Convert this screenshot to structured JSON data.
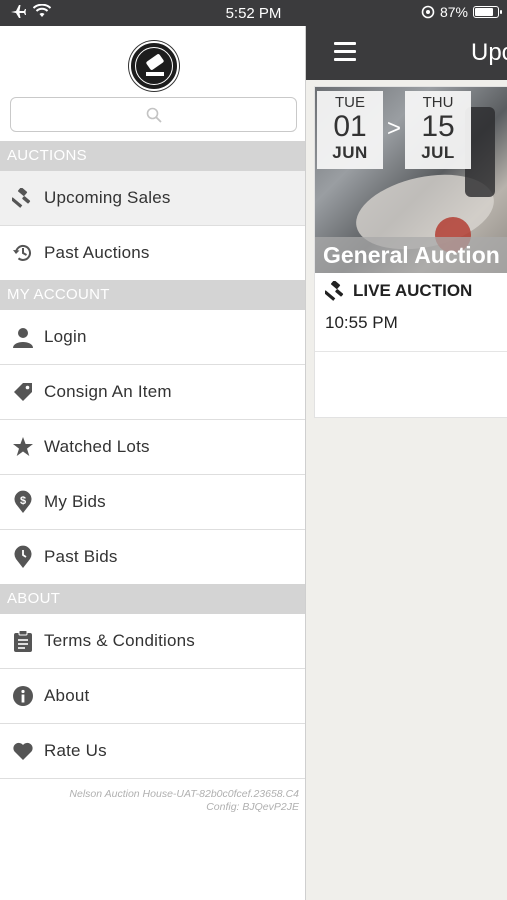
{
  "status_bar": {
    "time": "5:52 PM",
    "battery": "87%",
    "battery_level": 0.87
  },
  "main": {
    "title": "Upc",
    "card": {
      "start": {
        "dow": "TUE",
        "day": "01",
        "mon": "JUN"
      },
      "arrow": ">",
      "end": {
        "dow": "THU",
        "day": "15",
        "mon": "JUL"
      },
      "title": "General Auction",
      "type": "LIVE AUCTION",
      "time": "10:55 PM"
    }
  },
  "drawer": {
    "search_placeholder": "",
    "sections": {
      "auctions": "AUCTIONS",
      "my_account": "MY ACCOUNT",
      "about": "ABOUT"
    },
    "items": {
      "upcoming_sales": "Upcoming Sales",
      "past_auctions": "Past Auctions",
      "login": "Login",
      "consign": "Consign An Item",
      "watched": "Watched Lots",
      "my_bids": "My Bids",
      "past_bids": "Past Bids",
      "terms": "Terms & Conditions",
      "about": "About",
      "rate_us": "Rate Us"
    },
    "version_line1": "Nelson Auction House-UAT-82b0c0fcef.23658.C4",
    "version_line2": "Config: BJQevP2JE"
  },
  "icons": {
    "airplane": "airplane-icon",
    "wifi": "wifi-icon",
    "location": "location-icon",
    "gavel": "gavel-icon",
    "history": "history-icon",
    "person": "person-icon",
    "tag": "tag-icon",
    "star": "star-icon",
    "dollar": "dollar-pin-icon",
    "clock_pin": "clock-pin-icon",
    "clipboard": "clipboard-icon",
    "info": "info-icon",
    "heart": "heart-icon"
  },
  "colors": {
    "header_bg": "#3b3b3d",
    "section_bg": "#d4d4d4",
    "text": "#333333"
  }
}
